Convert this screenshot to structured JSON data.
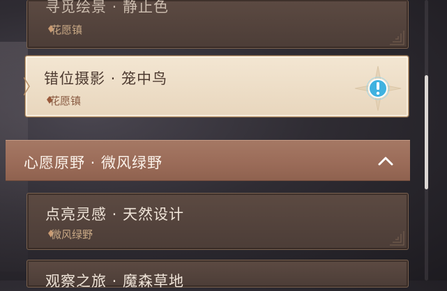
{
  "quest_list": {
    "items": [
      {
        "title": "寻觅绘景 · 静止色",
        "location": "花愿镇",
        "state": "partial"
      },
      {
        "title": "错位摄影 · 笼中鸟",
        "location": "花愿镇",
        "state": "selected",
        "alert_icon": "exclamation-icon"
      },
      {
        "title": "点亮灵感 · 天然设计",
        "location": "微风绿野",
        "state": "normal"
      },
      {
        "title": "观察之旅 · 魔森草地",
        "location": "",
        "state": "partial"
      }
    ]
  },
  "section": {
    "title": "心愿原野 · 微风绿野",
    "expanded": true
  },
  "scroll": {
    "position": 0.45
  },
  "colors": {
    "card_bg": "#5c4a42",
    "selected_bg": "#f3e6d2",
    "section_bg": "#a57864",
    "location_text": "#c8a885",
    "alert_blue": "#3fb2e0"
  }
}
